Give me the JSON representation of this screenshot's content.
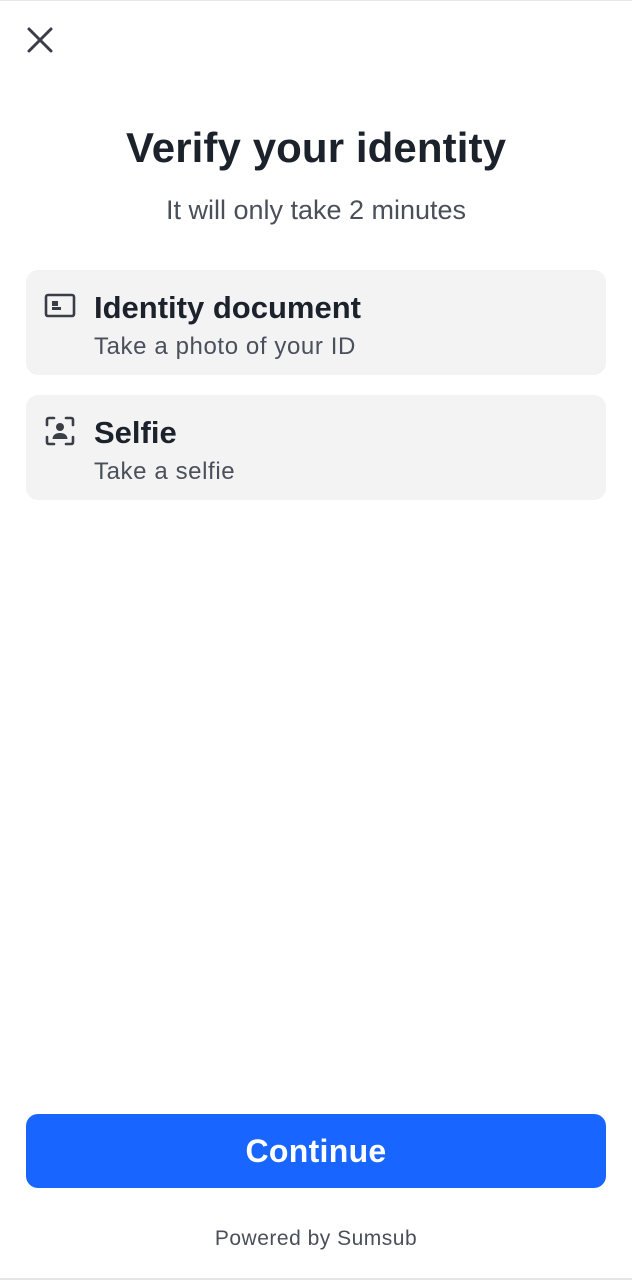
{
  "header": {
    "close_icon": "close-icon"
  },
  "main": {
    "title": "Verify your identity",
    "subtitle": "It will only take 2 minutes",
    "steps": [
      {
        "icon": "id-card-icon",
        "title": "Identity document",
        "subtitle": "Take a photo of your ID"
      },
      {
        "icon": "face-scan-icon",
        "title": "Selfie",
        "subtitle": "Take a selfie"
      }
    ]
  },
  "footer": {
    "continue_label": "Continue",
    "powered_by": "Powered by Sumsub"
  },
  "colors": {
    "accent": "#1866ff",
    "card_bg": "#f3f3f4",
    "text_primary": "#1c222b",
    "text_secondary": "#4a505a"
  }
}
